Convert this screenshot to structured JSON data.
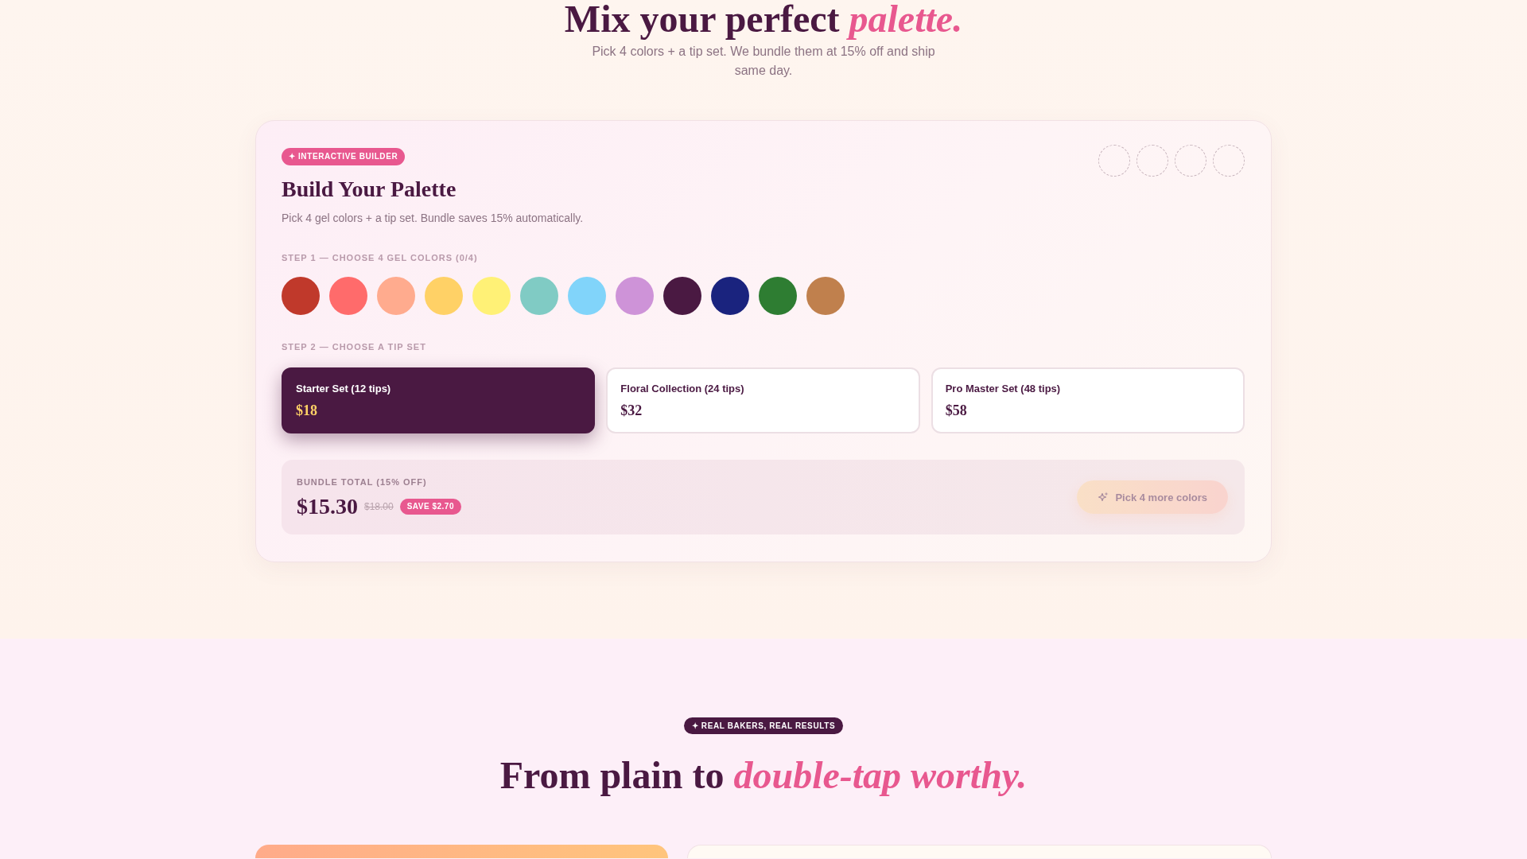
{
  "hero": {
    "title": "Mix your perfect *palette.*",
    "subtitle": "Pick 4 colors + a tip set. We bundle them at 15% off and ship same day."
  },
  "builder": {
    "badge": "✦ INTERACTIVE BUILDER",
    "title": "Build Your Palette",
    "description": "Pick 4 gel colors + a tip set. Bundle saves 15% automatically.",
    "slots": [
      {
        "filled": false
      },
      {
        "filled": false
      },
      {
        "filled": false
      },
      {
        "filled": false
      }
    ],
    "step_1": {
      "label": "STEP 1 — CHOOSE 4 GEL COLORS (0/4)",
      "swatches": [
        {
          "color": "#c0392b",
          "selected": false
        },
        {
          "color": "#ff6b6b",
          "selected": false
        },
        {
          "color": "#ffab8e",
          "selected": false
        },
        {
          "color": "#ffd166",
          "selected": false
        },
        {
          "color": "#fff176",
          "selected": false
        },
        {
          "color": "#80cbc4",
          "selected": false
        },
        {
          "color": "#81d4fa",
          "selected": false
        },
        {
          "color": "#ce93d8",
          "selected": false
        },
        {
          "color": "#4a1942",
          "selected": false
        },
        {
          "color": "#1a237e",
          "selected": false
        },
        {
          "color": "#2e7d32",
          "selected": false
        },
        {
          "color": "#c0804d",
          "selected": false
        }
      ]
    },
    "step_2": {
      "label": "STEP 2 — CHOOSE A TIP SET",
      "tip_sets": [
        {
          "name": "Starter Set (12 tips)",
          "price": "$18",
          "selected": true
        },
        {
          "name": "Floral Collection (24 tips)",
          "price": "$32",
          "selected": false
        },
        {
          "name": "Pro Master Set (48 tips)",
          "price": "$58",
          "selected": false
        }
      ]
    },
    "bundle": {
      "label": "BUNDLE TOTAL (15% OFF)",
      "price": "$15.30",
      "original_price": "$18.00",
      "savings": "SAVE $2.70",
      "button": {
        "label": "Pick 4 more colors",
        "disabled": true
      }
    }
  },
  "testimonials": {
    "badge": "✦ REAL BAKERS, REAL RESULTS",
    "title": "From plain to *double-tap worthy.*",
    "cards": [
      {
        "kind": "gradient"
      },
      {
        "kind": "plain"
      }
    ]
  }
}
